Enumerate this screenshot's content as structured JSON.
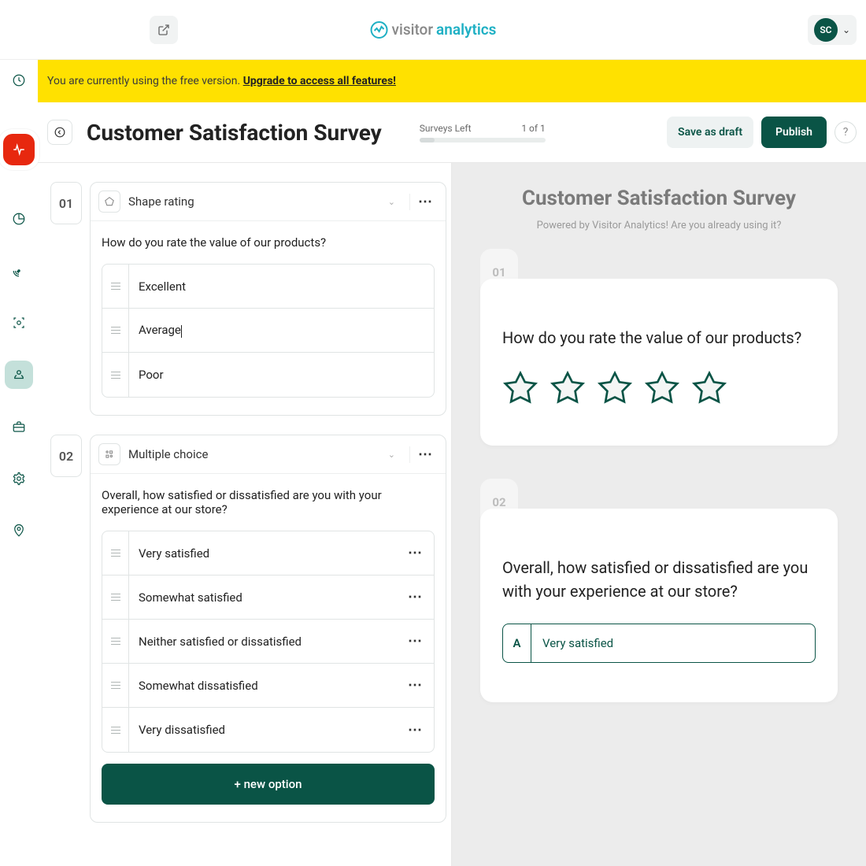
{
  "header": {
    "logo": {
      "part1": "visitor",
      "part2": "analytics"
    },
    "avatar_initials": "SC"
  },
  "banner": {
    "text": "You are currently using the free version. ",
    "link": "Upgrade to access all features!"
  },
  "page": {
    "title": "Customer Satisfaction Survey",
    "surveys_left_label": "Surveys Left",
    "surveys_left_value": "1 of 1",
    "save_draft": "Save as draft",
    "publish": "Publish"
  },
  "editor": {
    "questions": [
      {
        "number": "01",
        "type_label": "Shape rating",
        "type_icon": "pentagon",
        "text": "How do you rate the value of our products?",
        "options": [
          {
            "label": "Excellent",
            "more": false
          },
          {
            "label": "Average",
            "caret": true,
            "more": false
          },
          {
            "label": "Poor",
            "more": false
          }
        ]
      },
      {
        "number": "02",
        "type_label": "Multiple choice",
        "type_icon": "grid-dots",
        "text": "Overall, how satisfied or dissatisfied are you with your experience at our store?",
        "options": [
          {
            "label": "Very satisfied",
            "more": true
          },
          {
            "label": "Somewhat satisfied",
            "more": true
          },
          {
            "label": "Neither satisfied or dissatisfied",
            "more": true
          },
          {
            "label": "Somewhat dissatisfied",
            "more": true
          },
          {
            "label": "Very dissatisfied",
            "more": true
          }
        ],
        "new_option_label": "+ new option"
      }
    ]
  },
  "preview": {
    "title": "Customer Satisfaction Survey",
    "subtitle": "Powered by Visitor Analytics! Are you already using it?",
    "cards": [
      {
        "number": "01",
        "question": "How do you rate the value of our products?",
        "kind": "stars",
        "star_count": 5
      },
      {
        "number": "02",
        "question": "Overall, how satisfied or dissatisfied are you with your experience at our store?",
        "kind": "choice",
        "choice": {
          "letter": "A",
          "label": "Very satisfied"
        }
      }
    ]
  }
}
